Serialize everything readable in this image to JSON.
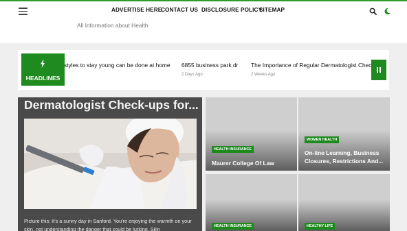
{
  "nav": {
    "menu_icon": "hamburger-menu-icon",
    "links": [
      "ADVERTISE HERE",
      "CONTACT US",
      "DISCLOSURE POLICY",
      "SITEMAP"
    ],
    "search_icon": "search-icon",
    "theme_icon": "moon-icon"
  },
  "site": {
    "tagline": "All Information about Health"
  },
  "ticker": {
    "label": "HEADLINES",
    "label_icon": "lightning-bolt-icon",
    "pause_icon": "pause-icon",
    "items": [
      {
        "title": "styles to stay young can be done at home",
        "date": ""
      },
      {
        "title": "6855 business park dr",
        "date": "2 Days Ago"
      },
      {
        "title": "The Importance of Regular Dermatologist Check-up",
        "date": "2 Weeks Ago"
      }
    ]
  },
  "featured": {
    "title": "Dermatologist Check-ups for...",
    "excerpt": "Picture this: It's a sunny day in Sanford. You're enjoying the warmth on your skin, not understanding the danger that could be lurking. Skin"
  },
  "cards": [
    {
      "category": "HEALTH INSURANCE",
      "title_lines": [
        "Maurer College Of Law"
      ]
    },
    {
      "category": "WOMEN HEALTH",
      "title_lines": [
        "On-line Learning, Business",
        "Closures, Restrictions And..."
      ]
    },
    {
      "category": "HEALTH INSURANCE",
      "title_lines": []
    },
    {
      "category": "HEALTHY LIFE",
      "title_lines": []
    }
  ],
  "colors": {
    "accent": "#1f8a1f",
    "header_bg": "#ffffff",
    "page_bg": "#efefef",
    "featured_bg": "#4a4a4a",
    "card_bg": "#cfcfcf"
  }
}
